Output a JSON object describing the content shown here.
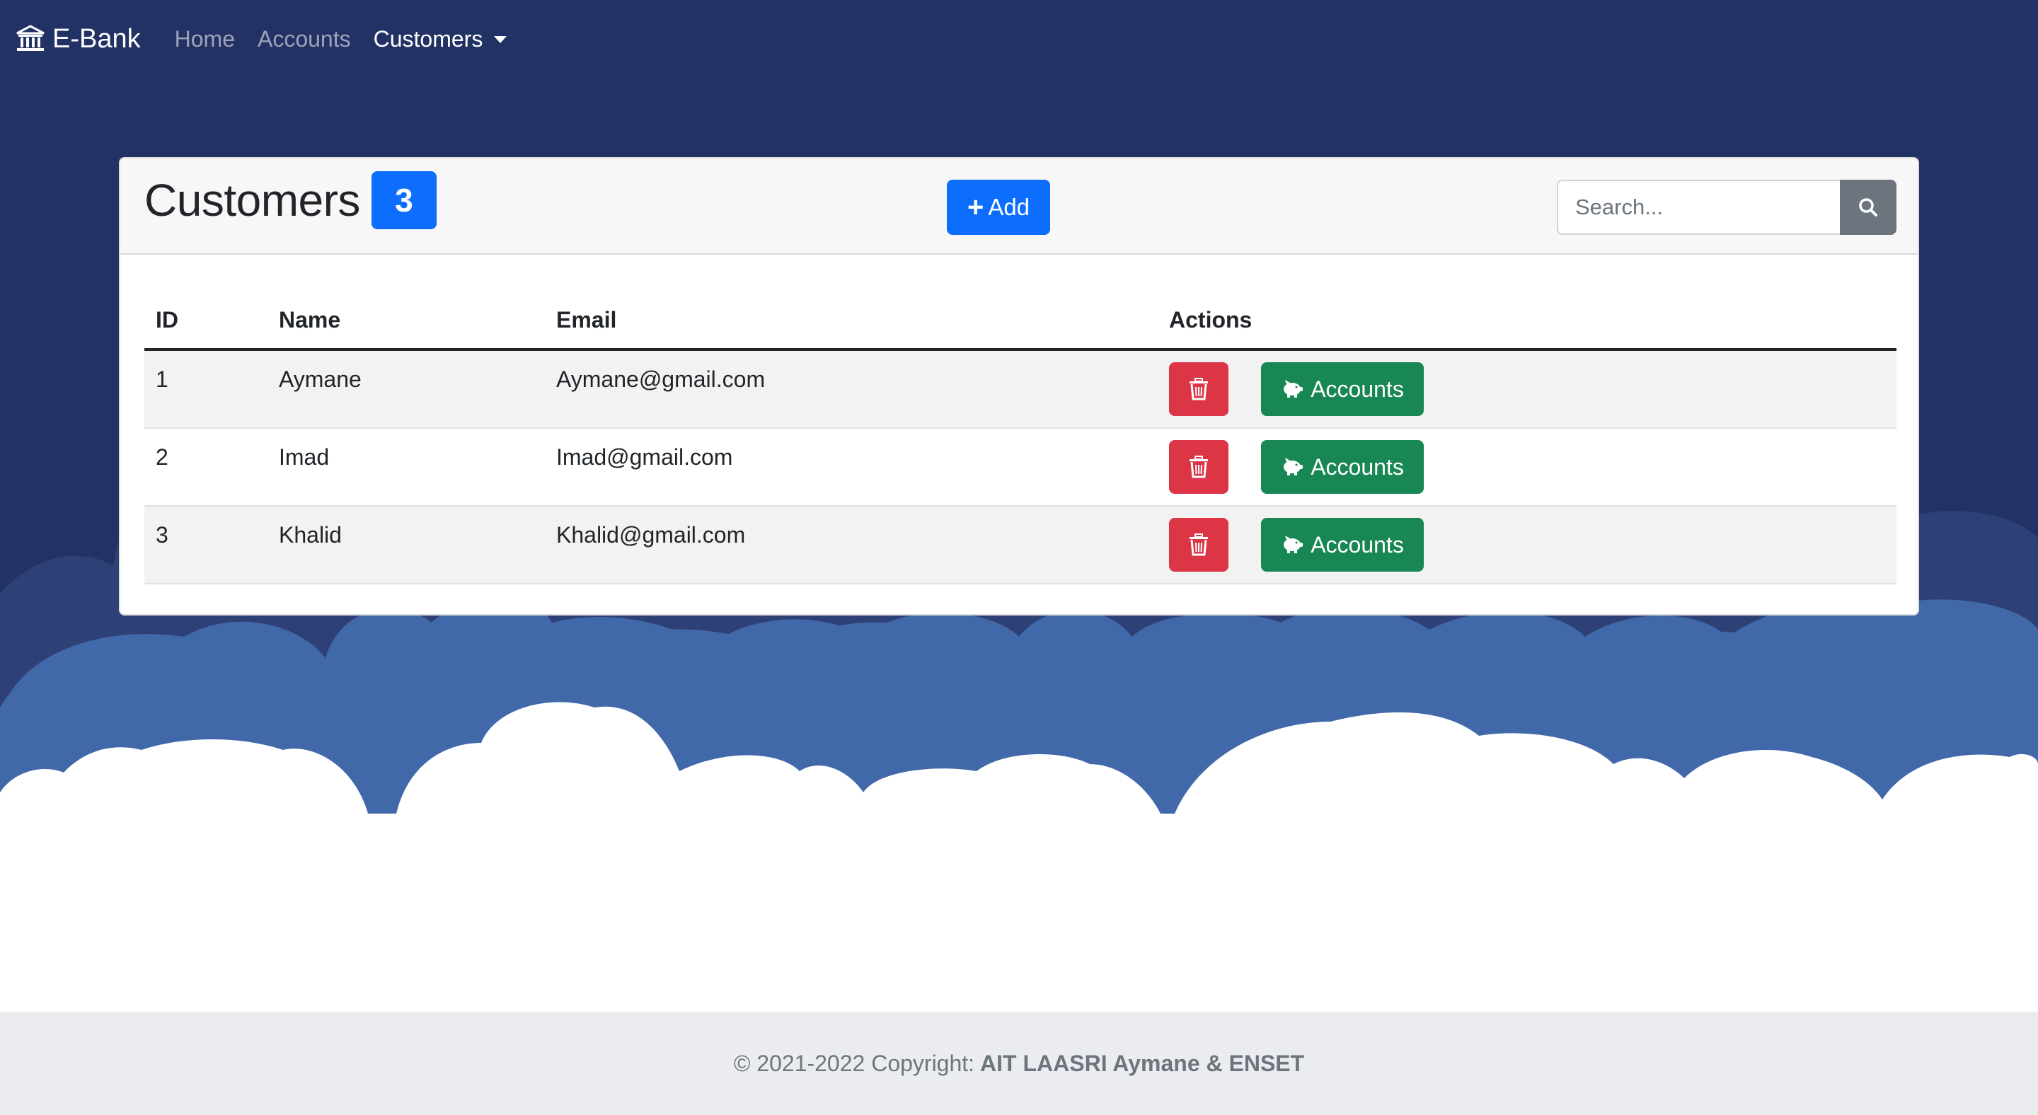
{
  "colors": {
    "navy": "#233264",
    "cloud_dark": "#2e4176",
    "cloud_blue": "#4169aa",
    "primary": "#0d6efd",
    "danger": "#dc3545",
    "success": "#198754",
    "secondary": "#6c757d"
  },
  "navbar": {
    "brand": "E-Bank",
    "brand_icon": "bank-icon",
    "links": [
      {
        "label": "Home",
        "active": false
      },
      {
        "label": "Accounts",
        "active": false
      },
      {
        "label": "Customers",
        "active": true,
        "dropdown": true
      }
    ]
  },
  "card": {
    "title": "Customers",
    "count": "3",
    "add_label": "Add",
    "search_placeholder": "Search...",
    "columns": [
      "ID",
      "Name",
      "Email",
      "Actions"
    ],
    "rows": [
      {
        "id": "1",
        "name": "Aymane",
        "email": "Aymane@gmail.com"
      },
      {
        "id": "2",
        "name": "Imad",
        "email": "Imad@gmail.com"
      },
      {
        "id": "3",
        "name": "Khalid",
        "email": "Khalid@gmail.com"
      }
    ],
    "accounts_button_label": "Accounts",
    "delete_icon": "trash-icon",
    "accounts_icon": "piggy-bank-icon"
  },
  "footer": {
    "prefix": "© 2021-2022 Copyright:",
    "owner": "AIT LAASRI Aymane & ENSET"
  }
}
